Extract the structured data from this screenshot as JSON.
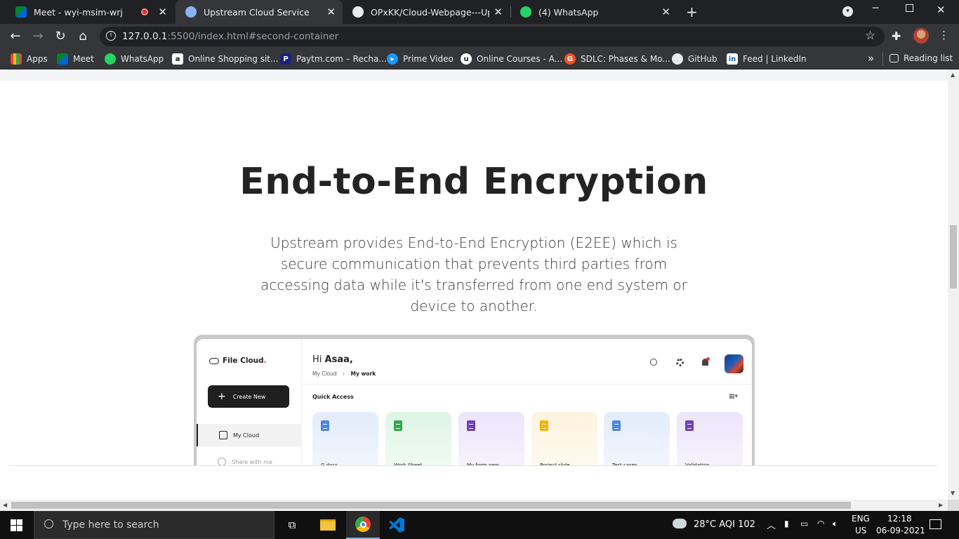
{
  "browser": {
    "tabs": [
      {
        "title": "Meet - wyi-msim-wrj",
        "active": false,
        "recording": true
      },
      {
        "title": "Upstream Cloud Service",
        "active": true
      },
      {
        "title": "OPxKK/Cloud-Webpage---Upstre",
        "active": false
      },
      {
        "title": "(4) WhatsApp",
        "active": false
      }
    ],
    "new_tab": "+",
    "url_host": "127.0.0.1",
    "url_rest": ":5500/index.html#second-container",
    "bookmarks": [
      {
        "label": "Apps"
      },
      {
        "label": "Meet"
      },
      {
        "label": "WhatsApp"
      },
      {
        "label": "Online Shopping sit..."
      },
      {
        "label": "Paytm.com – Recha..."
      },
      {
        "label": "Prime Video"
      },
      {
        "label": "Online Courses - A..."
      },
      {
        "label": "SDLC: Phases & Mo..."
      },
      {
        "label": "GitHub"
      },
      {
        "label": "Feed | LinkedIn"
      }
    ],
    "more_bookmarks": "»",
    "reading_list": "Reading list"
  },
  "page": {
    "heading": "End-to-End Encryption",
    "description": "Upstream provides End-to-End Encryption (E2EE) which is secure communication that prevents third parties from accessing data while it's transferred from one end system or device to another."
  },
  "mockup": {
    "brand": "File Cloud",
    "brand_dot": ".",
    "create_button": "Create New",
    "side_items": [
      "My Cloud",
      "Share with me"
    ],
    "greeting_prefix": "Hi ",
    "greeting_name": "Asaa,",
    "breadcrumb_root": "My Cloud",
    "breadcrumb_sep": "›",
    "breadcrumb_current": "My work",
    "quick_access": "Quick Access",
    "cards": [
      {
        "label": "G docs",
        "bg": "#e3ecfb",
        "icon": "#4a86e8"
      },
      {
        "label": "Work Sheet",
        "bg": "#dff5e4",
        "icon": "#2fa84f"
      },
      {
        "label": "My form new",
        "bg": "#ece5fb",
        "icon": "#6f3fbf"
      },
      {
        "label": "Project slide",
        "bg": "#fdf3df",
        "icon": "#f4b400"
      },
      {
        "label": "Test cases",
        "bg": "#e3ecfb",
        "icon": "#4a86e8"
      },
      {
        "label": "Validation",
        "bg": "#ece5fb",
        "icon": "#6f3fbf"
      }
    ]
  },
  "taskbar": {
    "search_placeholder": "Type here to search",
    "weather": "28°C  AQI 102",
    "lang_top": "ENG",
    "lang_bottom": "US",
    "time": "12:18",
    "date": "06-09-2021"
  }
}
